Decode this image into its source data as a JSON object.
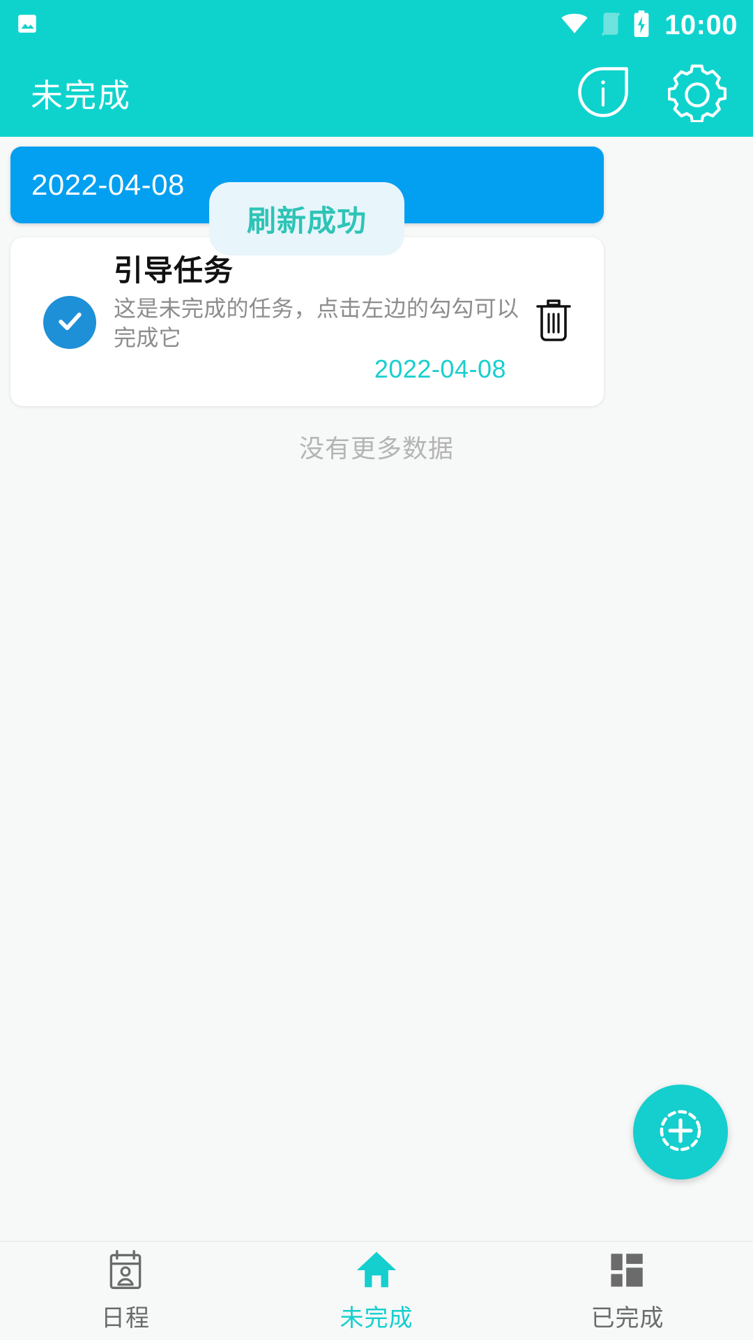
{
  "status_bar": {
    "left_icons": [
      "photo-icon"
    ],
    "wifi_icon": "wifi-icon",
    "sim_icon": "no-sim-icon",
    "battery_icon": "battery-charging-icon",
    "time": "10:00"
  },
  "app_bar": {
    "title": "未完成",
    "info_icon": "info-icon",
    "settings_icon": "gear-icon"
  },
  "date_header": {
    "date": "2022-04-08",
    "color": "#039ff0"
  },
  "toast": {
    "message": "刷新成功",
    "text_color": "#2dc4b6",
    "background": "#e8f5fb"
  },
  "task_list": {
    "items": [
      {
        "title": "引导任务",
        "description": "这是未完成的任务，点击左边的勾勾可以完成它",
        "date": "2022-04-08",
        "checked": true,
        "check_color": "#1e90d7",
        "date_color": "#18cfce",
        "delete_icon": "trash-icon"
      }
    ],
    "footer": "没有更多数据"
  },
  "fab": {
    "icon": "add-circle-dashed-icon",
    "color": "#14cfce"
  },
  "bottom_nav": {
    "active_color": "#14cfce",
    "inactive_color": "#6b6b6b",
    "items": [
      {
        "label": "日程",
        "icon": "calendar-person-icon",
        "active": false
      },
      {
        "label": "未完成",
        "icon": "home-icon",
        "active": true
      },
      {
        "label": "已完成",
        "icon": "grid-icon",
        "active": false
      }
    ]
  }
}
